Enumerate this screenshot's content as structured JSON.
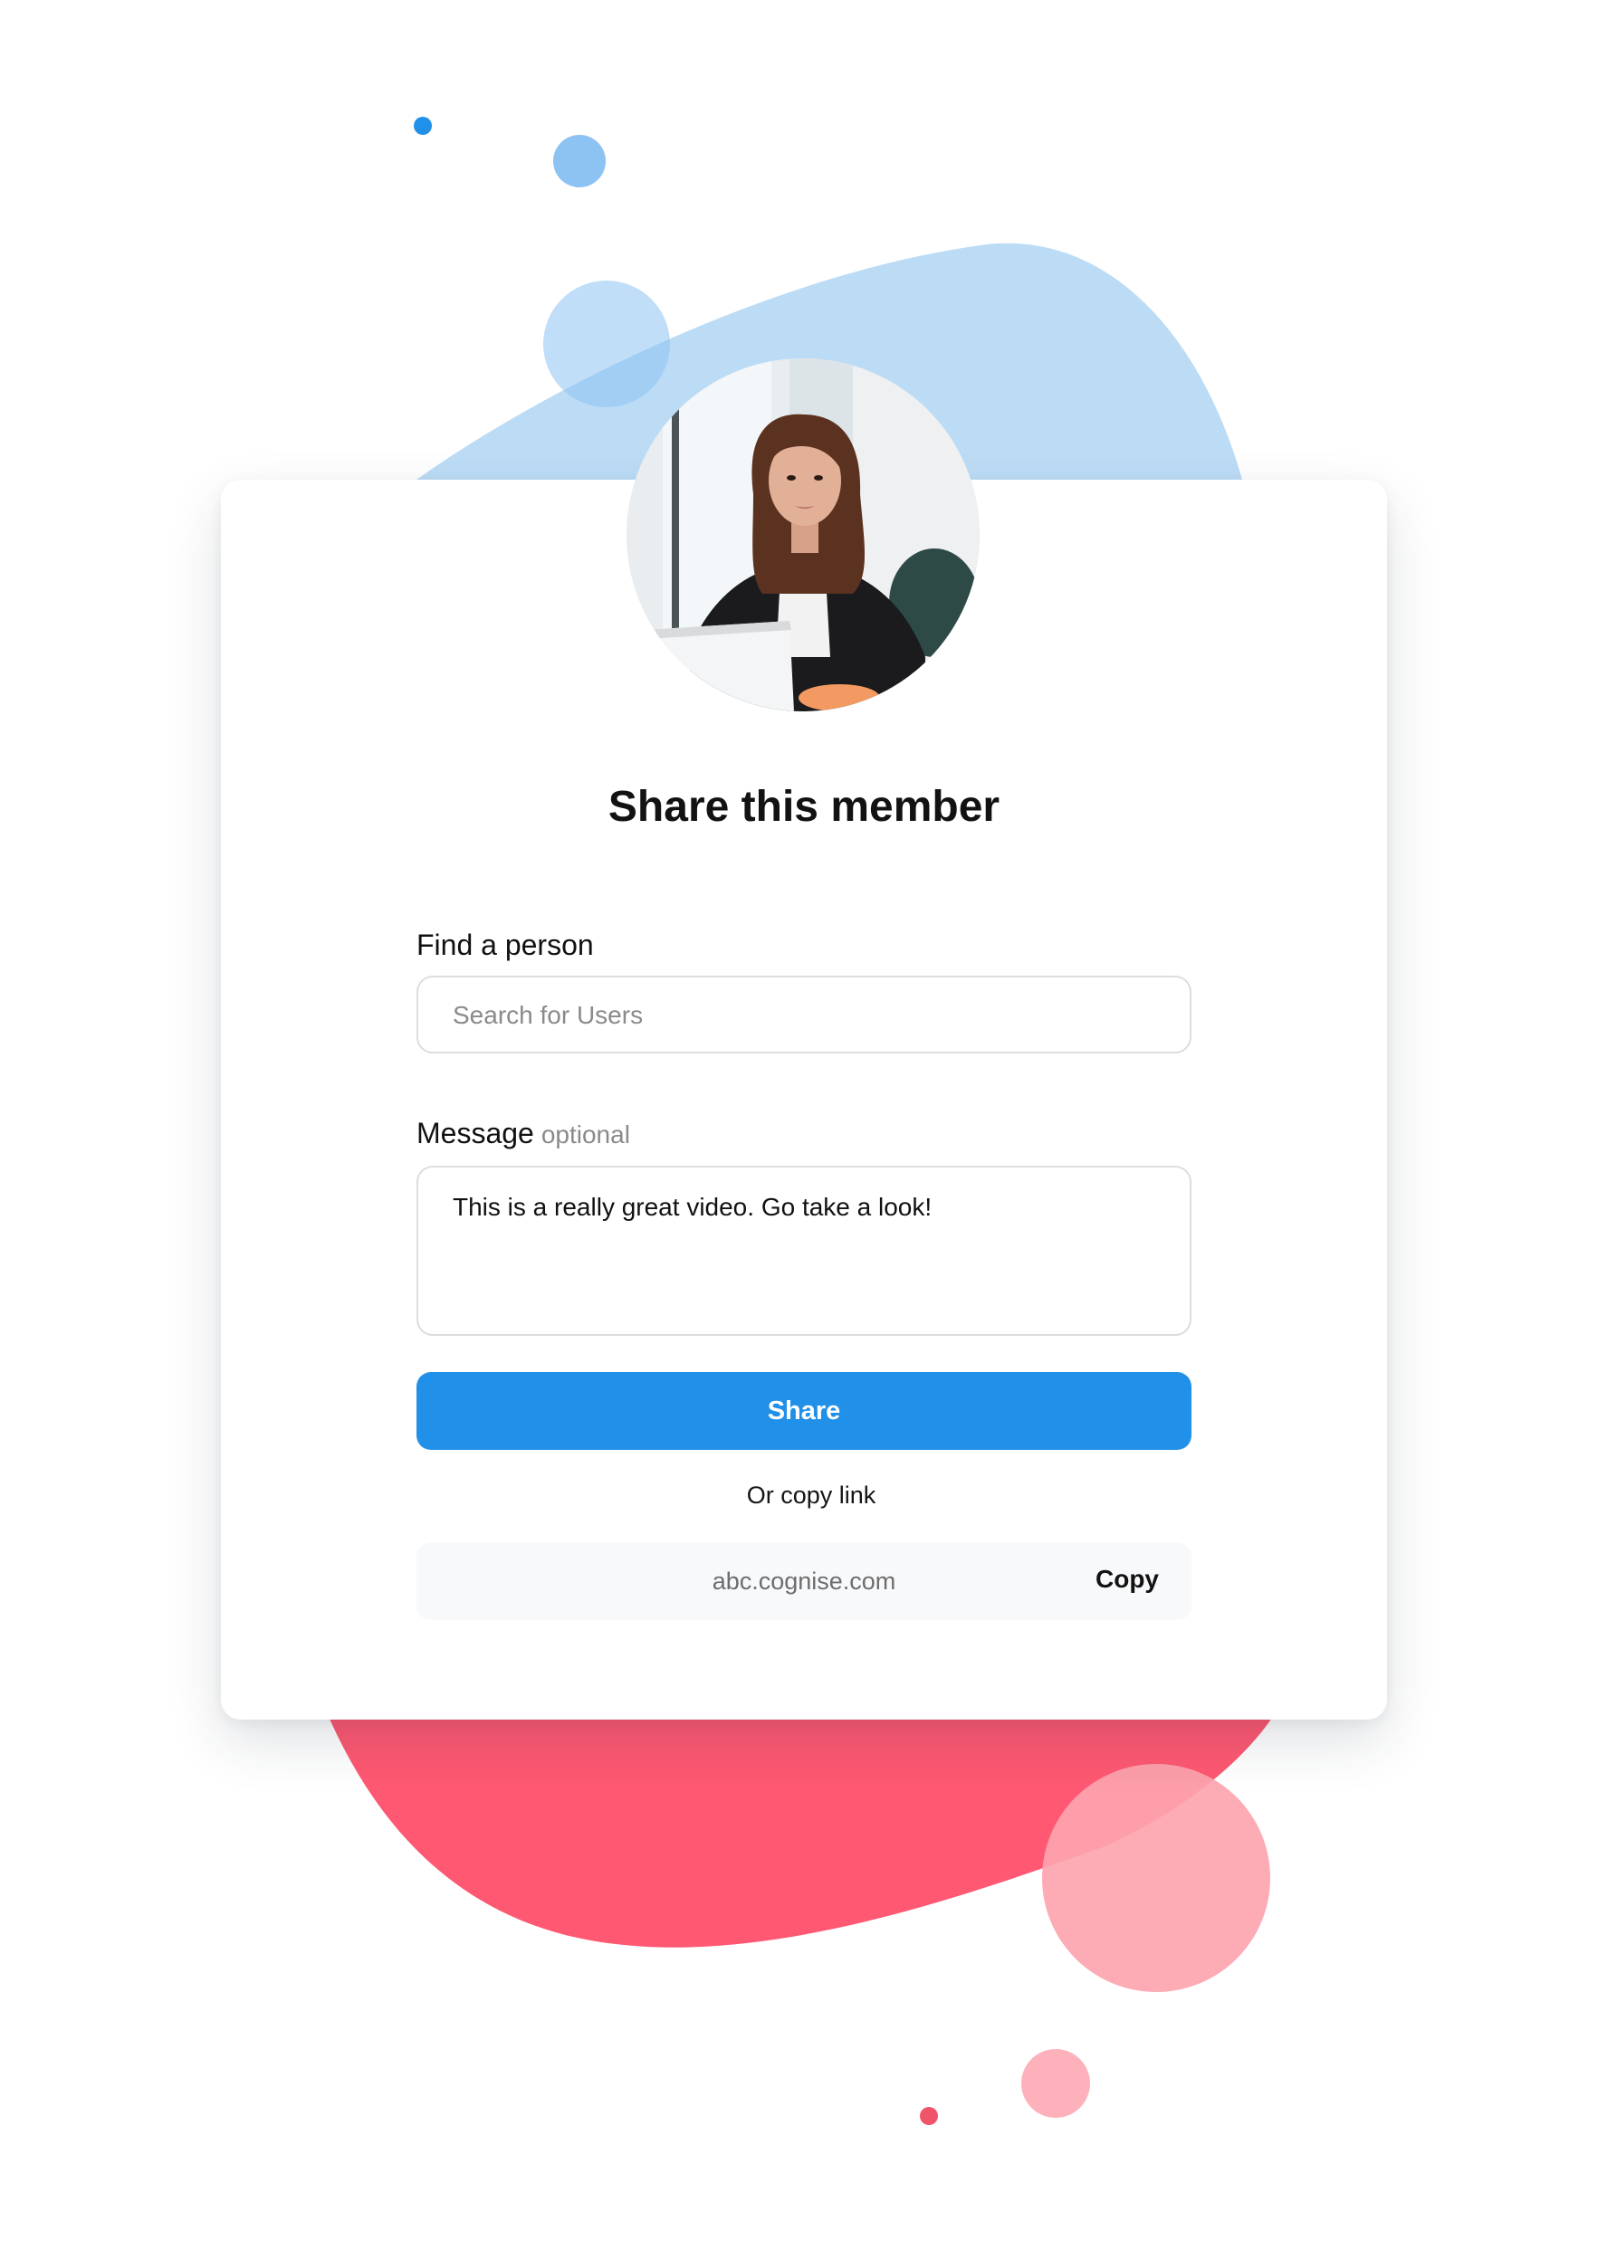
{
  "colors": {
    "accent": "#2190e8",
    "blue_blob": "#bcdcf6",
    "blue_dot": "#2190e8",
    "blue_circle": "#8cc3f2",
    "red_blob": "#fe5872",
    "pink_circle": "#fda4af",
    "red_dot": "#f0546b"
  },
  "dialog": {
    "title": "Share this member",
    "find_label": "Find a person",
    "search_placeholder": "Search for Users",
    "message_label": "Message",
    "message_optional": "optional",
    "message_value": "This is a really great video. Go take a look!",
    "share_button": "Share",
    "copy_caption": "Or copy link",
    "link_url": "abc.cognise.com",
    "copy_button": "Copy"
  }
}
